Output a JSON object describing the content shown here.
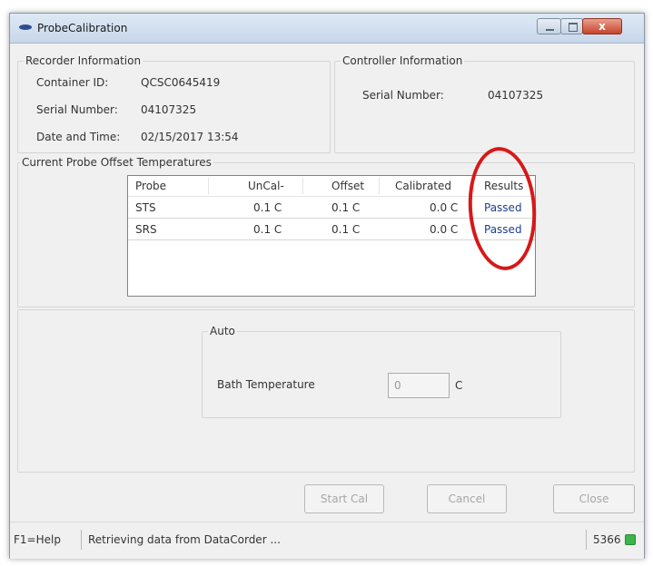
{
  "window": {
    "title": "ProbeCalibration",
    "close_glyph": "x"
  },
  "recorder_info": {
    "title": "Recorder Information",
    "container_id_label": "Container ID:",
    "container_id_value": "QCSC0645419",
    "serial_label": "Serial Number:",
    "serial_value": "04107325",
    "datetime_label": "Date and Time:",
    "datetime_value": "02/15/2017 13:54"
  },
  "controller_info": {
    "title": "Controller Information",
    "serial_label": "Serial Number:",
    "serial_value": "04107325"
  },
  "offsets": {
    "title": "Current Probe Offset Temperatures",
    "columns": [
      "Probe",
      "UnCal-",
      "Offset",
      "Calibrated",
      "Results"
    ],
    "rows": [
      [
        "STS",
        "0.1 C",
        "0.1 C",
        "0.0 C",
        "Passed"
      ],
      [
        "SRS",
        "0.1 C",
        "0.1 C",
        "0.0 C",
        "Passed"
      ]
    ]
  },
  "auto": {
    "title": "Auto",
    "bath_label": "Bath Temperature",
    "bath_value": "0",
    "bath_unit": "C"
  },
  "buttons": {
    "start_cal": "Start Cal",
    "cancel": "Cancel",
    "close": "Close"
  },
  "status": {
    "help": "F1=Help",
    "message": "Retrieving data from DataCorder ...",
    "code": "5366"
  },
  "colors": {
    "annotation": "#d71818",
    "results_text": "#1c3f8a",
    "status_indicator": "#3bb44a"
  }
}
